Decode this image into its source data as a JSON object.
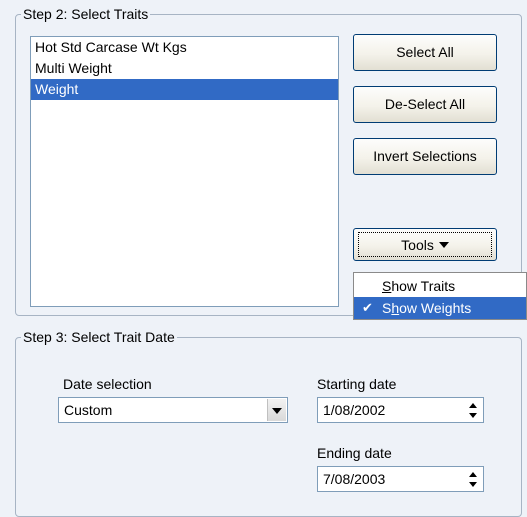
{
  "step2": {
    "title": "Step 2: Select Traits",
    "traits": [
      "Hot Std Carcase Wt Kgs",
      "Multi Weight",
      "Weight"
    ],
    "selected_trait": "Weight",
    "select_all_label": "Select All",
    "deselect_all_label": "De-Select All",
    "invert_label": "Invert Selections",
    "tools_label": "Tools",
    "tools_menu": {
      "show_traits_first": "S",
      "show_traits_rest": "how Traits",
      "show_weights_pre": "S",
      "show_weights_acc": "h",
      "show_weights_rest": "ow Weights",
      "show_weights_checked": true,
      "check_icon": "checkmark-icon"
    }
  },
  "step3": {
    "title": "Step 3: Select Trait Date",
    "date_selection_label": "Date selection",
    "date_selection_value": "Custom",
    "starting_date_label": "Starting date",
    "starting_date_value": "1/08/2002",
    "ending_date_label": "Ending date",
    "ending_date_value": "7/08/2003"
  },
  "colors": {
    "background": "#eef2f8",
    "selection": "#316ac5",
    "button_border": "#003c74"
  }
}
